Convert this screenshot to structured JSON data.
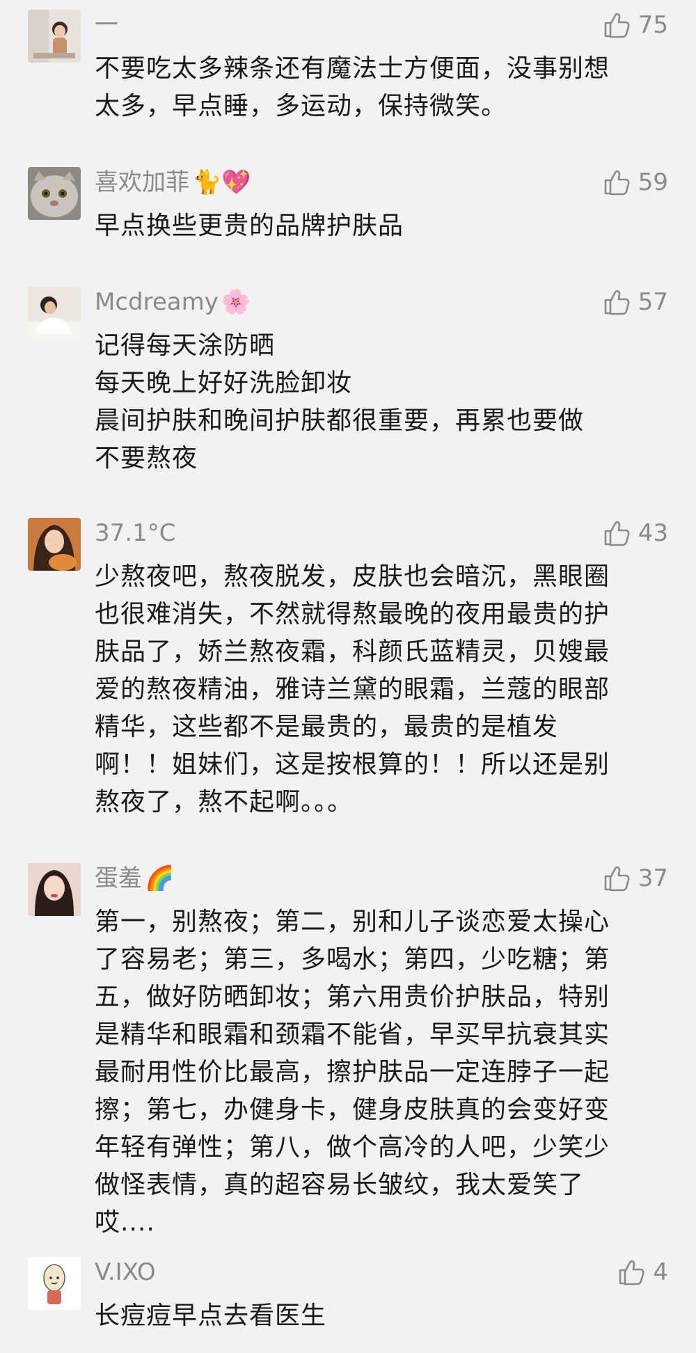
{
  "comments": [
    {
      "nickname": "一",
      "nickname_emoji": "",
      "likes": "75",
      "lines": [
        "不要吃太多辣条还有魔法士方便面，没事别想",
        "太多，早点睡，多运动，保持微笑。"
      ]
    },
    {
      "nickname": "喜欢加菲",
      "nickname_emoji": "🐈💖",
      "likes": "59",
      "lines": [
        "早点换些更贵的品牌护肤品"
      ]
    },
    {
      "nickname": "Mcdreamy",
      "nickname_emoji": "🌸",
      "likes": "57",
      "lines": [
        "记得每天涂防晒",
        "每天晚上好好洗脸卸妆",
        "晨间护肤和晚间护肤都很重要，再累也要做",
        "不要熬夜"
      ]
    },
    {
      "nickname": "37.1°C",
      "nickname_emoji": "",
      "likes": "43",
      "lines": [
        "少熬夜吧，熬夜脱发，皮肤也会暗沉，黑眼圈",
        "也很难消失，不然就得熬最晚的夜用最贵的护",
        "肤品了，娇兰熬夜霜，科颜氏蓝精灵，贝嫂最",
        "爱的熬夜精油，雅诗兰黛的眼霜，兰蔻的眼部",
        "精华，这些都不是最贵的，最贵的是植发",
        "啊！！姐妹们，这是按根算的！！所以还是别",
        "熬夜了，熬不起啊。。。"
      ]
    },
    {
      "nickname": "蛋羞",
      "nickname_emoji": "🌈",
      "likes": "37",
      "lines": [
        "第一，别熬夜；第二，别和儿子谈恋爱太操心",
        "了容易老；第三，多喝水；第四，少吃糖；第",
        "五，做好防晒卸妆；第六用贵价护肤品，特别",
        "是精华和眼霜和颈霜不能省，早买早抗衰其实",
        "最耐用性价比最高，擦护肤品一定连脖子一起",
        "擦；第七，办健身卡，健身皮肤真的会变好变",
        "年轻有弹性；第八，做个高冷的人吧，少笑少",
        "做怪表情，真的超容易长皱纹，我太爱笑了",
        "哎...."
      ]
    },
    {
      "nickname": "V.IXO",
      "nickname_emoji": "",
      "likes": "4",
      "lines": [
        "长痘痘早点去看医生"
      ]
    }
  ]
}
